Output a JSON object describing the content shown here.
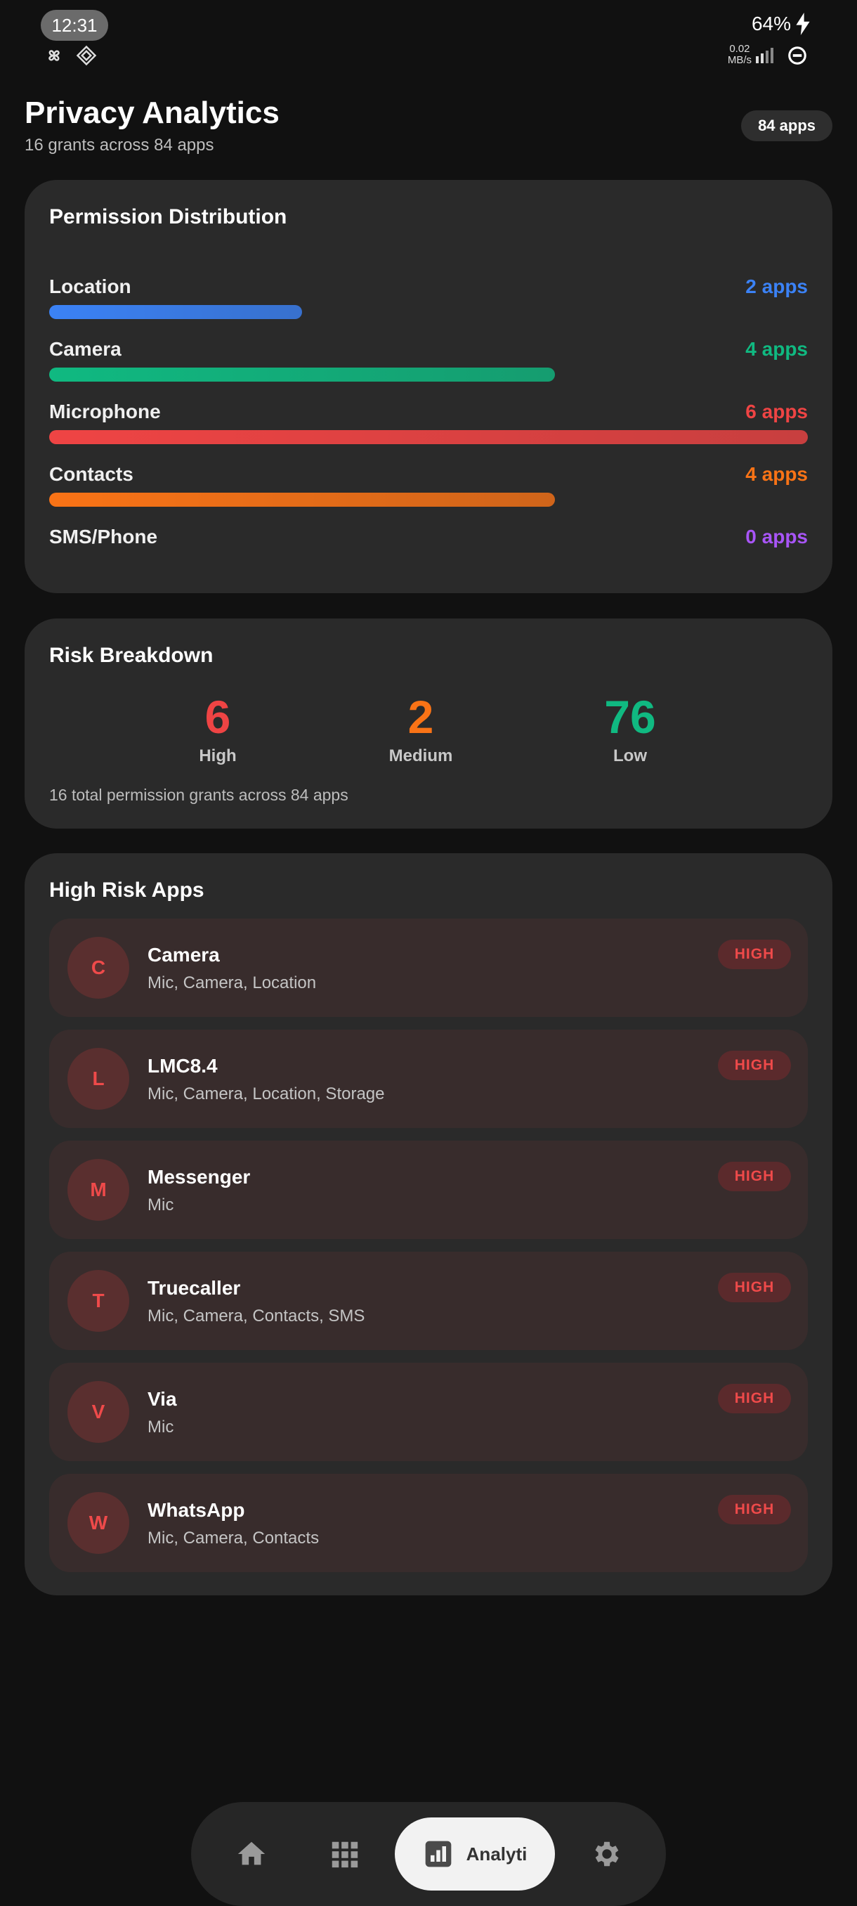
{
  "status_bar": {
    "time": "12:31",
    "battery": "64%",
    "net_speed_value": "0.02",
    "net_speed_unit": "MB/s"
  },
  "header": {
    "title": "Privacy Analytics",
    "subtitle": "16 grants across 84 apps",
    "apps_chip": "84 apps"
  },
  "permission_distribution": {
    "title": "Permission Distribution",
    "items": [
      {
        "label": "Location",
        "count_label": "2 apps",
        "count": 2,
        "color": "#3b82f6"
      },
      {
        "label": "Camera",
        "count_label": "4 apps",
        "count": 4,
        "color": "#10b981"
      },
      {
        "label": "Microphone",
        "count_label": "6 apps",
        "count": 6,
        "color": "#ef4444"
      },
      {
        "label": "Contacts",
        "count_label": "4 apps",
        "count": 4,
        "color": "#f97316"
      },
      {
        "label": "SMS/Phone",
        "count_label": "0 apps",
        "count": 0,
        "color": "#a855f7"
      }
    ]
  },
  "risk_breakdown": {
    "title": "Risk Breakdown",
    "high_value": "6",
    "high_label": "High",
    "medium_value": "2",
    "medium_label": "Medium",
    "low_value": "76",
    "low_label": "Low",
    "footnote": "16 total permission grants across 84 apps",
    "colors": {
      "high": "#ef4444",
      "medium": "#f97316",
      "low": "#10b981"
    }
  },
  "high_risk_apps": {
    "title": "High Risk Apps",
    "apps": [
      {
        "initial": "C",
        "name": "Camera",
        "permissions": "Mic, Camera, Location",
        "badge": "HIGH"
      },
      {
        "initial": "L",
        "name": "LMC8.4",
        "permissions": "Mic, Camera, Location, Storage",
        "badge": "HIGH"
      },
      {
        "initial": "M",
        "name": "Messenger",
        "permissions": "Mic",
        "badge": "HIGH"
      },
      {
        "initial": "T",
        "name": "Truecaller",
        "permissions": "Mic, Camera, Contacts, SMS",
        "badge": "HIGH"
      },
      {
        "initial": "V",
        "name": "Via",
        "permissions": "Mic",
        "badge": "HIGH"
      },
      {
        "initial": "W",
        "name": "WhatsApp",
        "permissions": "Mic, Camera, Contacts",
        "badge": "HIGH"
      }
    ]
  },
  "bottom_nav": {
    "items": [
      "home-icon",
      "apps-grid-icon",
      "analytics-icon",
      "settings-icon"
    ],
    "active_label": "Analyti"
  }
}
